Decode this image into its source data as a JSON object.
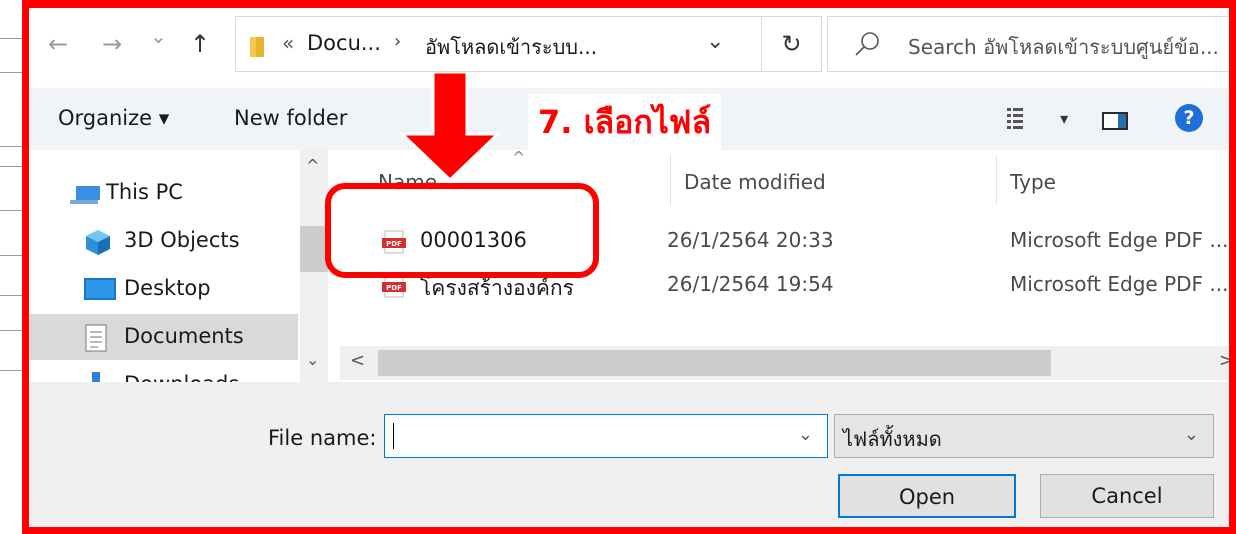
{
  "window": {
    "nav_back_glyph": "←",
    "nav_forward_glyph": "→",
    "nav_recent_glyph": "⌄",
    "nav_up_glyph": "↑"
  },
  "address_bar": {
    "overflow": "«",
    "crumb1": "Docu...",
    "separator": "›",
    "crumb2": "อัพโหลดเข้าระบบ...",
    "dropdown_glyph": "⌄",
    "refresh_glyph": "↻"
  },
  "search": {
    "placeholder": "Search อัพโหลดเข้าระบบศูนย์ข้อ..."
  },
  "toolbar": {
    "organize_label": "Organize ▾",
    "new_folder_label": "New folder",
    "view_dropdown_glyph": "▾",
    "help_label": "?"
  },
  "nav_pane": {
    "scroll_up_glyph": "^",
    "scroll_down_glyph": "⌄",
    "items": [
      {
        "label": "This PC",
        "icon": "computer-icon"
      },
      {
        "label": "3D Objects",
        "icon": "cube-icon"
      },
      {
        "label": "Desktop",
        "icon": "desktop-icon"
      },
      {
        "label": "Documents",
        "icon": "documents-icon",
        "selected": true
      },
      {
        "label": "Downloads",
        "icon": "downloads-icon"
      }
    ]
  },
  "file_list": {
    "columns": {
      "name": "Name",
      "date": "Date modified",
      "type": "Type"
    },
    "sort_glyph": "^",
    "rows": [
      {
        "name": "00001306",
        "date": "26/1/2564 20:33",
        "type": "Microsoft Edge PDF ..."
      },
      {
        "name": "โครงสร้างองค์กร",
        "date": "26/1/2564 19:54",
        "type": "Microsoft Edge PDF ..."
      }
    ],
    "hscroll_left": "<",
    "hscroll_right": ">",
    "pdf_badge": "PDF"
  },
  "bottom": {
    "file_name_label": "File name:",
    "file_name_value": "",
    "file_type_value": "ไฟล์ทั้งหมด",
    "dropdown_glyph": "⌄",
    "open_label": "Open",
    "cancel_label": "Cancel"
  },
  "annotation": {
    "label": "7. เลือกไฟล์",
    "color": "#ff0000"
  }
}
